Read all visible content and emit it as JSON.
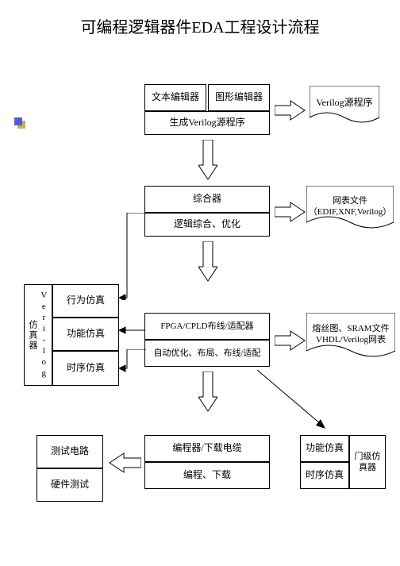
{
  "title": "可编程逻辑器件EDA工程设计流程",
  "stage1": {
    "text_editor": "文本编辑器",
    "graph_editor": "图形编辑器",
    "gen_verilog": "生成Verilog源程序",
    "output_doc": "Verilog源程序"
  },
  "stage2": {
    "synth": "综合器",
    "logic_opt": "逻辑综合、优化",
    "output_doc": "网表文件\n（EDIF,XNF,Verilog）"
  },
  "sim_left": {
    "header": "Veri-log仿真器",
    "behav": "行为仿真",
    "func": "功能仿真",
    "timing": "时序仿真"
  },
  "stage3": {
    "fitter": "FPGA/CPLD布线/适配器",
    "auto": "自动优化、布局、布线/适配",
    "output_doc": "熔丝图、SRAM文件\nVHDL/Verilog网表"
  },
  "stage4": {
    "prog_cable": "编程器/下载电缆",
    "prog_dl": "编程、下载"
  },
  "hw_left": {
    "test_circuit": "测试电路",
    "hw_test": "硬件测试"
  },
  "gate_right": {
    "func": "功能仿真",
    "timing": "时序仿真",
    "gate_sim": "门级仿真器"
  },
  "chart_data": {
    "type": "flowchart",
    "nodes": [
      {
        "id": "editors",
        "label": "文本编辑器 / 图形编辑器 / 生成Verilog源程序"
      },
      {
        "id": "src_doc",
        "label": "Verilog源程序",
        "shape": "document"
      },
      {
        "id": "synth",
        "label": "综合器 / 逻辑综合、优化"
      },
      {
        "id": "netlist_doc",
        "label": "网表文件（EDIF,XNF,Verilog）",
        "shape": "document"
      },
      {
        "id": "vlog_sim",
        "label": "Verilog仿真器：行为仿真 / 功能仿真 / 时序仿真"
      },
      {
        "id": "fitter",
        "label": "FPGA/CPLD布线/适配器 / 自动优化、布局、布线/适配"
      },
      {
        "id": "fuse_doc",
        "label": "熔丝图、SRAM文件 / VHDL/Verilog网表",
        "shape": "document"
      },
      {
        "id": "prog",
        "label": "编程器/下载电缆 / 编程、下载"
      },
      {
        "id": "hw",
        "label": "测试电路 / 硬件测试"
      },
      {
        "id": "gate_sim",
        "label": "门级仿真器：功能仿真 / 时序仿真"
      }
    ],
    "edges": [
      {
        "from": "editors",
        "to": "src_doc"
      },
      {
        "from": "editors",
        "to": "synth"
      },
      {
        "from": "synth",
        "to": "netlist_doc"
      },
      {
        "from": "synth",
        "to": "fitter"
      },
      {
        "from": "synth",
        "to": "vlog_sim",
        "label": "行为仿真"
      },
      {
        "from": "fitter",
        "to": "vlog_sim",
        "label": "功能/时序仿真"
      },
      {
        "from": "fitter",
        "to": "fuse_doc"
      },
      {
        "from": "fitter",
        "to": "prog"
      },
      {
        "from": "fitter",
        "to": "gate_sim"
      },
      {
        "from": "prog",
        "to": "hw"
      }
    ]
  }
}
